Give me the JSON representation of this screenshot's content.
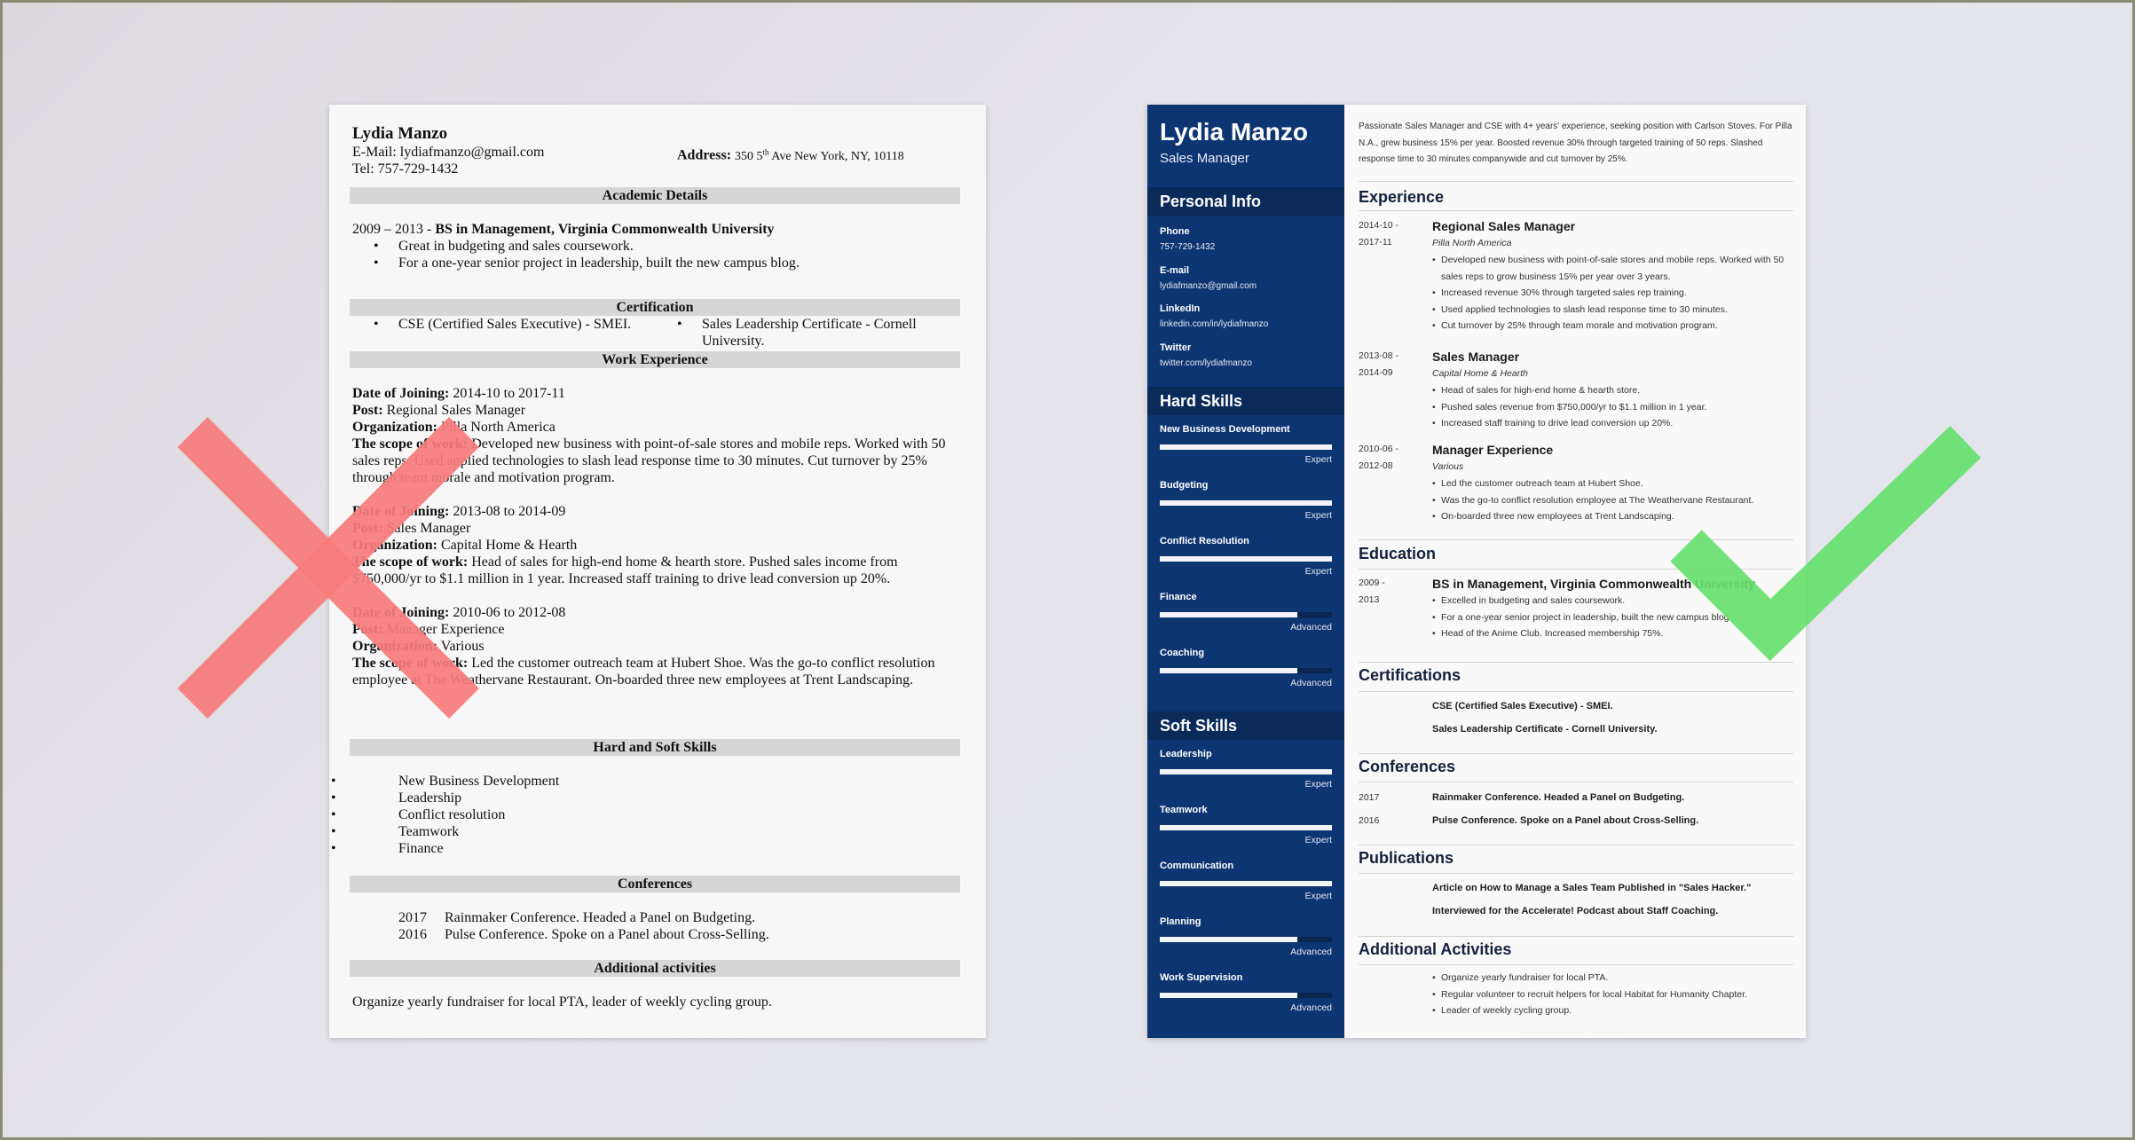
{
  "colors": {
    "sidebar_bg": "#0d3572",
    "sidebar_header_bg": "#0a2a5a",
    "bad_mark": "#f77b7b",
    "good_mark": "#66df6e"
  },
  "bad_resume": {
    "name": "Lydia Manzo",
    "email_label": "E-Mail:",
    "email": "lydiafmanzo@gmail.com",
    "tel_label": "Tel:",
    "tel": "757-729-1432",
    "address_label": "Address:",
    "address_pre": "350 5",
    "address_sup": "th",
    "address_post": " Ave New York, NY, 10118",
    "sections": {
      "academic": "Academic Details",
      "certification": "Certification",
      "work": "Work Experience",
      "skills": "Hard and Soft Skills",
      "conferences": "Conferences",
      "activities": "Additional activities"
    },
    "education": {
      "years": "2009 – 2013 - ",
      "degree": "BS in Management, Virginia Commonwealth University",
      "bullets": [
        "Great in budgeting and sales coursework.",
        "For a one-year senior project in leadership, built the new campus blog."
      ]
    },
    "certifications": [
      "CSE (Certified Sales Executive) - SMEI.",
      "Sales Leadership Certificate - Cornell University."
    ],
    "labels": {
      "date": "Date of Joining:",
      "post": "Post:",
      "org": "Organization:",
      "scope": "The scope of work:"
    },
    "jobs": [
      {
        "date": "2014-10 to 2017-11",
        "post": "Regional Sales Manager",
        "org": "Pilla North America",
        "scope": "Developed new business with point-of-sale stores and mobile reps. Worked with 50 sales reps. Used applied technologies to slash lead response time to 30 minutes. Cut turnover by 25% through team morale and motivation program."
      },
      {
        "date": "2013-08 to 2014-09",
        "post": "Sales Manager",
        "org": "Capital Home & Hearth",
        "scope": "Head of sales for high-end home & hearth store. Pushed sales income from $750,000/yr to $1.1 million in 1 year. Increased staff training to drive lead conversion up 20%."
      },
      {
        "date": "2010-06 to 2012-08",
        "post": "Manager Experience",
        "org": "Various",
        "scope": "Led the customer outreach team at Hubert Shoe. Was the go-to conflict resolution employee at The Weathervane Restaurant. On-boarded three new employees at Trent Landscaping."
      }
    ],
    "skills": [
      "New Business Development",
      "Leadership",
      "Conflict resolution",
      "Teamwork",
      "Finance"
    ],
    "conferences": [
      {
        "year": "2017",
        "text": "Rainmaker Conference. Headed a Panel on Budgeting."
      },
      {
        "year": "2016",
        "text": "Pulse Conference. Spoke on a Panel about Cross-Selling."
      }
    ],
    "activities": "Organize yearly fundraiser for local PTA, leader of weekly cycling group."
  },
  "good_resume": {
    "name": "Lydia Manzo",
    "title": "Sales Manager",
    "sidebar": {
      "personal_info_heading": "Personal Info",
      "info": [
        {
          "label": "Phone",
          "value": "757-729-1432"
        },
        {
          "label": "E-mail",
          "value": "lydiafmanzo@gmail.com"
        },
        {
          "label": "LinkedIn",
          "value": "linkedin.com/in/lydiafmanzo"
        },
        {
          "label": "Twitter",
          "value": "twitter.com/lydiafmanzo"
        }
      ],
      "hard_skills_heading": "Hard Skills",
      "hard_skills": [
        {
          "name": "New Business Development",
          "level": "Expert",
          "fill_percent": 100
        },
        {
          "name": "Budgeting",
          "level": "Expert",
          "fill_percent": 100
        },
        {
          "name": "Conflict Resolution",
          "level": "Expert",
          "fill_percent": 100
        },
        {
          "name": "Finance",
          "level": "Advanced",
          "fill_percent": 80
        },
        {
          "name": "Coaching",
          "level": "Advanced",
          "fill_percent": 80
        }
      ],
      "soft_skills_heading": "Soft Skills",
      "soft_skills": [
        {
          "name": "Leadership",
          "level": "Expert",
          "fill_percent": 100
        },
        {
          "name": "Teamwork",
          "level": "Expert",
          "fill_percent": 100
        },
        {
          "name": "Communication",
          "level": "Expert",
          "fill_percent": 100
        },
        {
          "name": "Planning",
          "level": "Advanced",
          "fill_percent": 80
        },
        {
          "name": "Work Supervision",
          "level": "Advanced",
          "fill_percent": 80
        }
      ]
    },
    "summary": "Passionate Sales Manager and CSE with 4+ years' experience, seeking position with Carlson Stoves. For Pilla N.A., grew business 15% per year. Boosted revenue 30% through targeted training of 50 reps. Slashed response time to 30 minutes companywide and cut turnover by 25%.",
    "headings": {
      "experience": "Experience",
      "education": "Education",
      "certifications": "Certifications",
      "conferences": "Conferences",
      "publications": "Publications",
      "activities": "Additional Activities"
    },
    "experience": [
      {
        "start": "2014-10 -",
        "end": "2017-11",
        "title": "Regional Sales Manager",
        "org": "Pilla North America",
        "bullets": [
          "Developed new business with point-of-sale stores and mobile reps. Worked with 50 sales reps to grow business 15% per year over 3 years.",
          "Increased revenue 30% through targeted sales rep training.",
          "Used applied technologies to slash lead response time to 30 minutes.",
          "Cut turnover by 25% through team morale and motivation program."
        ]
      },
      {
        "start": "2013-08 -",
        "end": "2014-09",
        "title": "Sales Manager",
        "org": "Capital Home & Hearth",
        "bullets": [
          "Head of sales for high-end home & hearth store.",
          "Pushed sales revenue from $750,000/yr to $1.1 million in 1 year.",
          "Increased staff training to drive lead conversion up 20%."
        ]
      },
      {
        "start": "2010-06 -",
        "end": "2012-08",
        "title": "Manager Experience",
        "org": "Various",
        "bullets": [
          "Led the customer outreach team at Hubert Shoe.",
          "Was the go-to conflict resolution employee at The Weathervane Restaurant.",
          "On-boarded three new employees at Trent Landscaping."
        ]
      }
    ],
    "education": {
      "start": "2009 -",
      "end": "2013",
      "degree": "BS in Management, Virginia Commonwealth University",
      "bullets": [
        "Excelled in budgeting and sales coursework.",
        "For a one-year senior project in leadership, built the new campus blog.",
        "Head of the Anime Club. Increased membership 75%."
      ]
    },
    "certifications": [
      "CSE (Certified Sales Executive) - SMEI.",
      "Sales Leadership Certificate - Cornell University."
    ],
    "conferences": [
      {
        "year": "2017",
        "text": "Rainmaker Conference. Headed a Panel on Budgeting."
      },
      {
        "year": "2016",
        "text": "Pulse Conference. Spoke on a Panel about Cross-Selling."
      }
    ],
    "publications": [
      "Article on How to Manage a Sales Team Published in \"Sales Hacker.\"",
      "Interviewed for the Accelerate! Podcast about Staff Coaching."
    ],
    "activities": [
      "Organize yearly fundraiser for local PTA.",
      "Regular volunteer to recruit helpers for local Habitat for Humanity Chapter.",
      "Leader of weekly cycling group."
    ]
  }
}
